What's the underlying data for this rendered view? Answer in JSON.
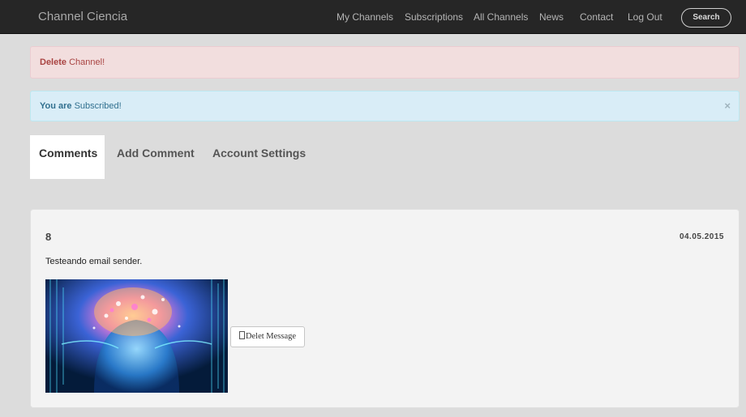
{
  "navbar": {
    "brand": "Channel Ciencia",
    "links": [
      "My Channels",
      "Subscriptions",
      "All Channels",
      "News",
      "Contact",
      "Log Out"
    ],
    "search_label": "Search"
  },
  "alerts": {
    "danger": {
      "bold": "Delete",
      "text": "Channel!"
    },
    "info": {
      "bold": "You are",
      "text": "Subscribed!",
      "close": "×"
    }
  },
  "tabs": [
    "Comments",
    "Add Comment",
    "Account Settings"
  ],
  "active_tab": "Comments",
  "message": {
    "id": "8",
    "date": "04.05.2015",
    "text": "Testeando email sender.",
    "delete_label": "Delet Message"
  },
  "colors": {
    "navbar": "#262626",
    "danger_bg": "#f2dede",
    "info_bg": "#d9edf7",
    "page_bg": "#dcdcdc"
  }
}
